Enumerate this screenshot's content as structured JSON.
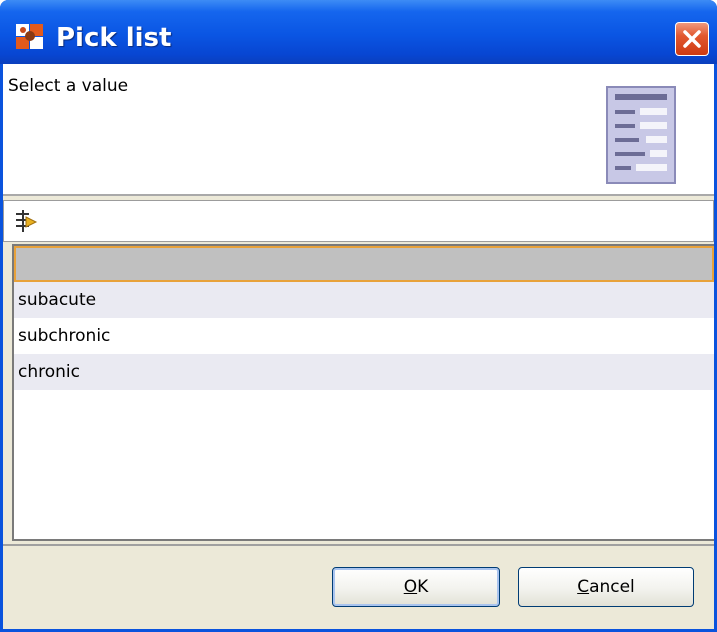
{
  "window": {
    "title": "Pick list",
    "close_icon": "close-icon",
    "app_icon": "app-logo-icon"
  },
  "banner": {
    "message": "Select a value",
    "icon": "list-document-icon"
  },
  "filter": {
    "icon": "filter-icon",
    "value": ""
  },
  "list": {
    "selected_index": 0,
    "items": [
      {
        "label": ""
      },
      {
        "label": "subacute"
      },
      {
        "label": "subchronic"
      },
      {
        "label": "chronic"
      }
    ]
  },
  "buttons": {
    "ok": {
      "mnemonic": "O",
      "rest": "K"
    },
    "cancel": {
      "mnemonic": "C",
      "rest": "ancel"
    }
  },
  "colors": {
    "titlebar": "#0a55e3",
    "selection": "#c0c0c0",
    "selection_border": "#e8a23a",
    "alt_row": "#eaeaf2",
    "close_button": "#e2582f"
  }
}
